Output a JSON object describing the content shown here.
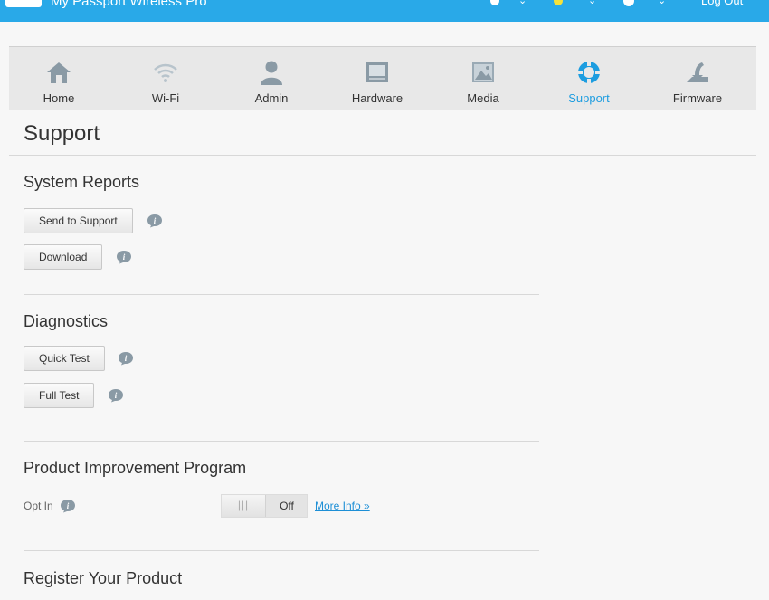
{
  "app": {
    "title": "My Passport Wireless Pro",
    "logout_label": "Log Out"
  },
  "nav": {
    "items": [
      {
        "label": "Home",
        "icon": "home-icon"
      },
      {
        "label": "Wi-Fi",
        "icon": "wifi-icon"
      },
      {
        "label": "Admin",
        "icon": "user-icon"
      },
      {
        "label": "Hardware",
        "icon": "hardware-icon"
      },
      {
        "label": "Media",
        "icon": "image-icon"
      },
      {
        "label": "Support",
        "icon": "lifebuoy-icon",
        "active": true
      },
      {
        "label": "Firmware",
        "icon": "firmware-icon"
      }
    ],
    "active_color": "#1d9de0"
  },
  "page": {
    "title": "Support"
  },
  "system_reports": {
    "title": "System Reports",
    "send_label": "Send to Support",
    "download_label": "Download"
  },
  "diagnostics": {
    "title": "Diagnostics",
    "quick_label": "Quick Test",
    "full_label": "Full Test"
  },
  "product_improvement": {
    "title": "Product Improvement Program",
    "optin_label": "Opt In",
    "toggle_grip": "|||",
    "toggle_state": "Off",
    "more_info": "More Info »"
  },
  "register": {
    "title": "Register Your Product"
  },
  "colors": {
    "topbar": "#29a9e8",
    "link": "#1d8fd6"
  }
}
